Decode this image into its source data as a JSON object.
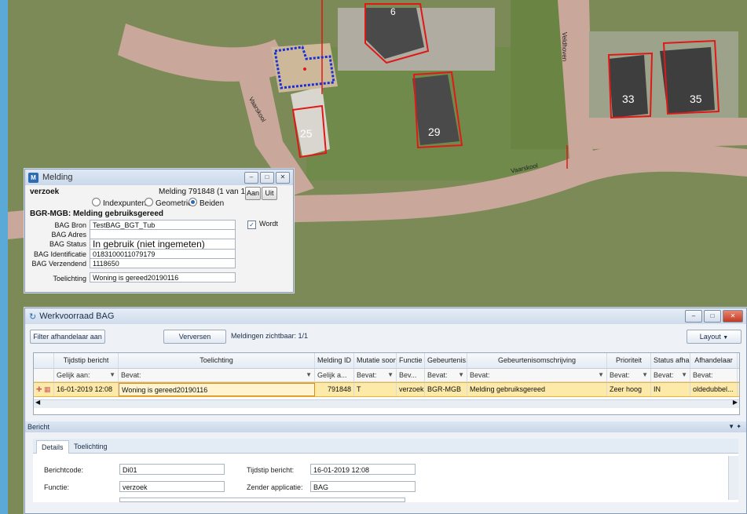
{
  "map": {
    "street_labels": [
      "Vaarskool",
      "Vaarskool",
      "Veldhoven"
    ],
    "house_numbers": [
      "6",
      "25",
      "29",
      "33",
      "35"
    ]
  },
  "melding": {
    "title": "Melding",
    "verzoek_label": "verzoek",
    "counter": "Melding 791848 (1 van 1)",
    "btn_aan": "Aan",
    "btn_uit": "Uit",
    "radio_options": [
      "Indexpunten",
      "Geometrie",
      "Beiden"
    ],
    "radio_selected": "Beiden",
    "section_title": "BGR-MGB: Melding gebruiksgereed",
    "fields": [
      {
        "label": "BAG Bron",
        "value": "TestBAG_BGT_Tub"
      },
      {
        "label": "BAG Adres",
        "value": ""
      },
      {
        "label": "BAG Status",
        "value": "In gebruik (niet ingemeten)"
      },
      {
        "label": "BAG Identificatie",
        "value": "0183100011079179"
      },
      {
        "label": "BAG Verzendend",
        "value": "1118650"
      }
    ],
    "wordt_label": "Wordt",
    "toelichting_label": "Toelichting",
    "toelichting_value": "Woning is gereed20190116"
  },
  "werk": {
    "title": "Werkvoorraad BAG",
    "filter_btn": "Filter afhandelaar aan",
    "refresh_btn": "Verversen",
    "visible_text": "Meldingen zichtbaar: 1/1",
    "layout_btn": "Layout",
    "columns": [
      "Tijdstip bericht",
      "Toelichting",
      "Melding ID",
      "Mutatie soort",
      "Functie",
      "Gebeurtenis...",
      "Gebeurtenisomschrijving",
      "Prioriteit",
      "Status afha...",
      "Afhandelaar"
    ],
    "filters": [
      "Gelijk aan:",
      "Bevat:",
      "Gelijk a...",
      "Bevat:",
      "Bev...",
      "Bevat:",
      "Bevat:",
      "Bevat:",
      "Bevat:",
      "Bevat:"
    ],
    "row": [
      "16-01-2019 12:08",
      "Woning is gereed20190116",
      "791848",
      "T",
      "verzoek",
      "BGR-MGB",
      "Melding gebruiksgereed",
      "Zeer hoog",
      "IN",
      "oldedubbel..."
    ],
    "bericht_label": "Bericht",
    "tabs": [
      "Details",
      "Toelichting"
    ],
    "form": {
      "berichtcode_label": "Berichtcode:",
      "berichtcode_value": "Di01",
      "functie_label": "Functie:",
      "functie_value": "verzoek",
      "tijdstip_label": "Tijdstip bericht:",
      "tijdstip_value": "16-01-2019 12:08",
      "zender_label": "Zender applicatie:",
      "zender_value": "BAG"
    }
  }
}
